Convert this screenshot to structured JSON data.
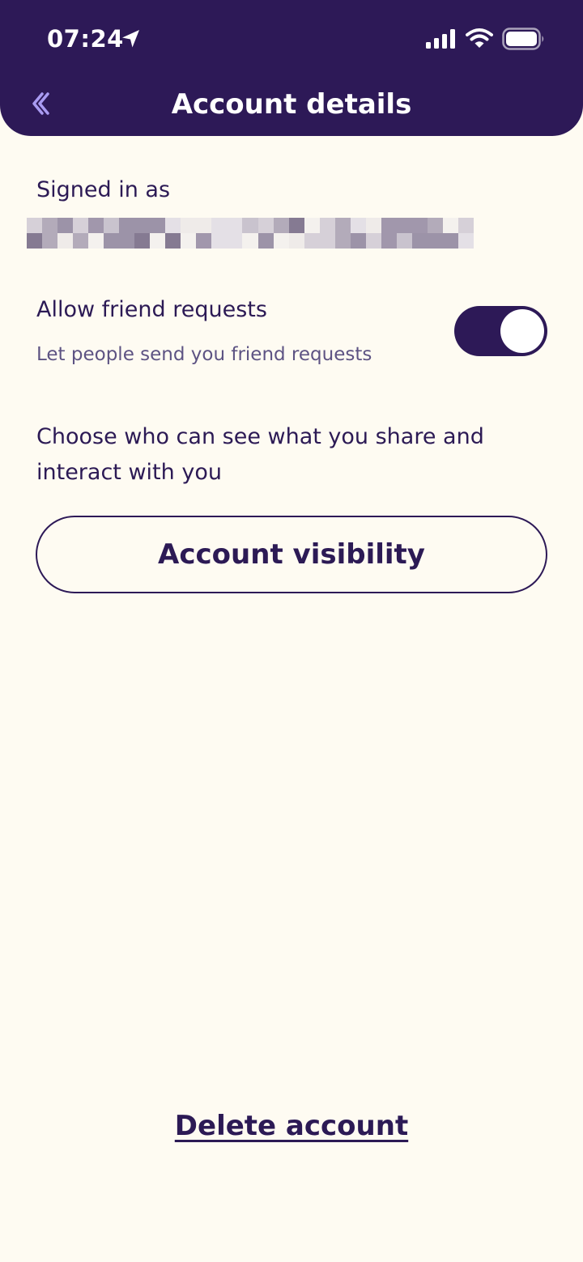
{
  "status_bar": {
    "time": "07:24"
  },
  "header": {
    "title": "Account details",
    "back_icon": "chevron-left-icon"
  },
  "account": {
    "signed_in_label": "Signed in as"
  },
  "friend_requests": {
    "title": "Allow friend requests",
    "subtitle": "Let people send you friend requests",
    "enabled": true
  },
  "visibility": {
    "description": "Choose who can see what you share and interact with you",
    "button_label": "Account visibility"
  },
  "footer": {
    "delete_label": "Delete account"
  },
  "colors": {
    "header_bg": "#2D1957",
    "page_bg": "#FEFBF2",
    "text": "#2C1A55",
    "accent": "#A99BF2"
  }
}
